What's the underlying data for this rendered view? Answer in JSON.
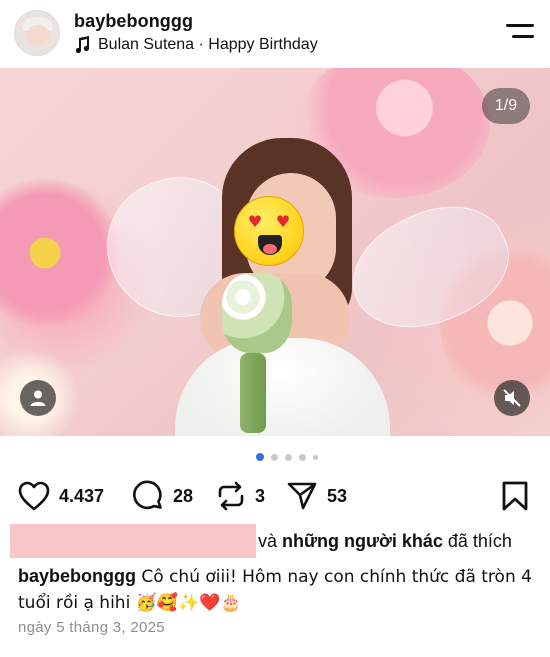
{
  "header": {
    "username": "baybebonggg",
    "music": "Bulan Sutena · Happy Birthday"
  },
  "photo": {
    "counter": "1/9",
    "alt_subject": "child in fairy costume with bouquet"
  },
  "carousel": {
    "total_dots": 5,
    "active_index": 0
  },
  "actions": {
    "likes": "4.437",
    "comments": "28",
    "reposts": "3",
    "shares": "53"
  },
  "liked_by": {
    "suffix_prefix": "và ",
    "others_label": "những người khác",
    "suffix_end": " đã thích"
  },
  "caption": {
    "username": "baybebonggg",
    "text": " Cô chú ơiii! Hôm nay con chính thức đã tròn 4 tuổi rồi ạ hihi 🥳🥰✨❤️🎂"
  },
  "date": "ngày 5 tháng 3, 2025",
  "colors": {
    "accent_dot": "#3b6fe0",
    "redaction": "#f9c7c9"
  },
  "icons": [
    "music-note-icon",
    "menu-icon",
    "user-icon",
    "mute-icon",
    "heart-icon",
    "comment-icon",
    "repost-icon",
    "share-icon",
    "bookmark-icon"
  ]
}
